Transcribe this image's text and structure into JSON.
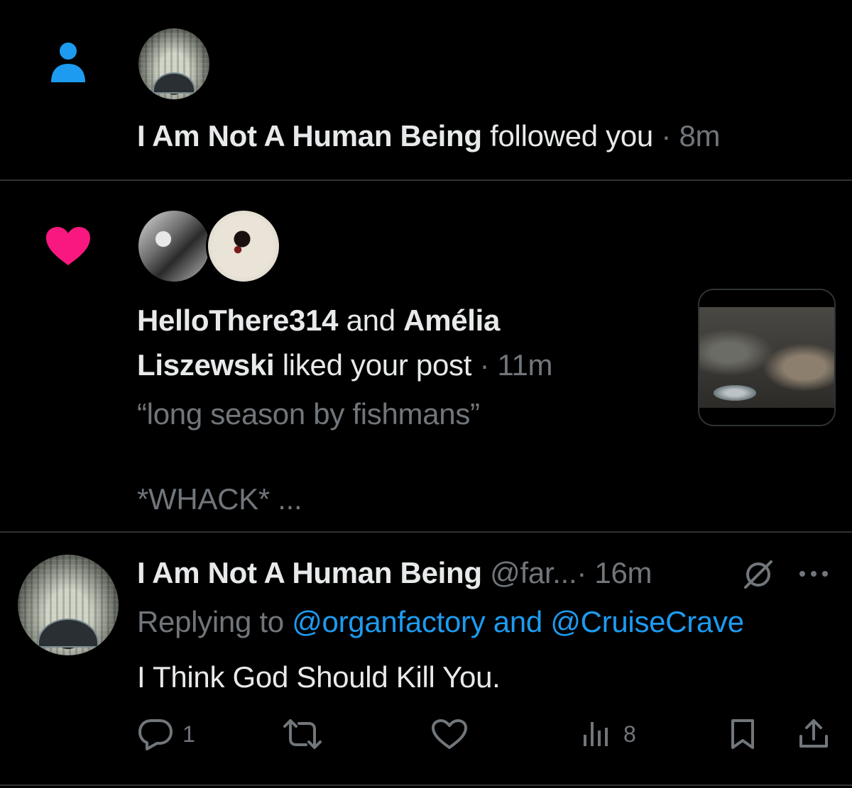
{
  "follow": {
    "icon": "person-icon",
    "icon_color": "#1d9bf0",
    "name": "I Am Not A Human Being",
    "action": "followed you",
    "dot": "·",
    "time": "8m"
  },
  "like": {
    "icon": "heart-icon",
    "icon_color": "#f91880",
    "user1": "HelloThere314",
    "conj": "and",
    "user2_line1": "Amélia",
    "user2_line2": "Liszewski",
    "action": "liked your post",
    "dot": "·",
    "time": "11m",
    "quote": "“long season by fishmans”",
    "snippet": "*WHACK* ..."
  },
  "reply": {
    "name": "I Am Not A Human Being",
    "handle": "@far...",
    "dot": "·",
    "time": "16m",
    "replying_prefix": "Replying to",
    "replying_targets": "@organfactory and @CruiseCrave",
    "text": "I Think God Should Kill You.",
    "more": "···",
    "actions": {
      "reply_count": "1",
      "views_count": "8"
    }
  },
  "colors": {
    "background": "#000000",
    "text": "#e7e9ea",
    "muted": "#71767b",
    "accent": "#1d9bf0",
    "like": "#f91880",
    "divider": "#2f3336"
  }
}
